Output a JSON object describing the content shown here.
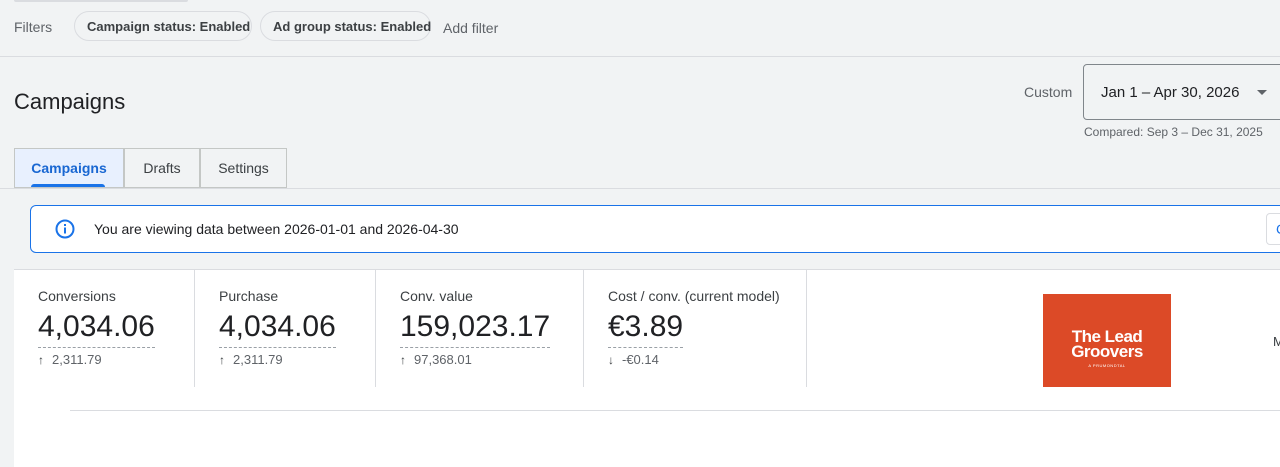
{
  "filters": {
    "label": "Filters",
    "chips": [
      "Campaign status: Enabled",
      "Ad group status: Enabled"
    ],
    "add_filter": "Add filter"
  },
  "page": {
    "title": "Campaigns"
  },
  "date_range": {
    "label": "Custom",
    "value": "Jan 1 – Apr 30, 2026",
    "compared": "Compared: Sep 3 – Dec 31, 2025"
  },
  "tabs": [
    "Campaigns",
    "Drafts",
    "Settings"
  ],
  "active_tab": "Campaigns",
  "banner": {
    "text": "You are viewing data between 2026-01-01 and 2026-04-30",
    "button_label": "C"
  },
  "scorecards": [
    {
      "label": "Conversions",
      "value": "4,034.06",
      "change": "2,311.79",
      "direction": "up"
    },
    {
      "label": "Purchase",
      "value": "4,034.06",
      "change": "2,311.79",
      "direction": "up"
    },
    {
      "label": "Conv. value",
      "value": "159,023.17",
      "change": "97,368.01",
      "direction": "up"
    },
    {
      "label": "Cost / conv. (current model)",
      "value": "€3.89",
      "change": "-€0.14",
      "direction": "down"
    }
  ],
  "logo": {
    "line1": "The Lead",
    "line2": "Groovers",
    "sub": "A PRUMONDTAL",
    "color": "#dc4a27"
  },
  "edge_text": "M",
  "colors": {
    "accent": "#1a73e8",
    "active_tab_bg": "#e8f0fe",
    "page_bg": "#f1f3f4"
  }
}
